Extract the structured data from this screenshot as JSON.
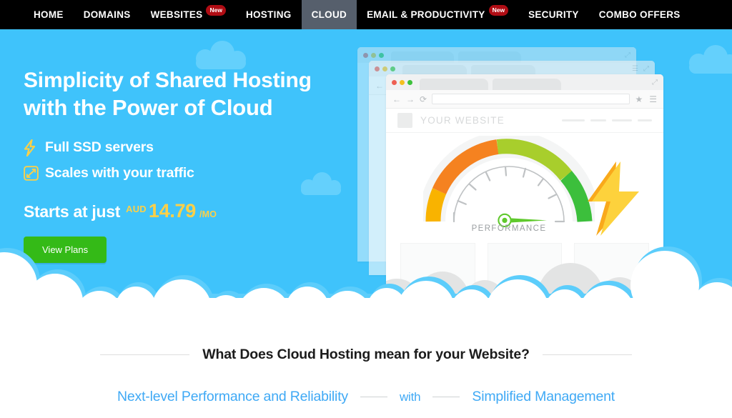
{
  "nav": {
    "items": [
      {
        "label": "HOME",
        "badge": null,
        "active": false
      },
      {
        "label": "DOMAINS",
        "badge": null,
        "active": false
      },
      {
        "label": "WEBSITES",
        "badge": "New",
        "active": false
      },
      {
        "label": "HOSTING",
        "badge": null,
        "active": false
      },
      {
        "label": "CLOUD",
        "badge": null,
        "active": true
      },
      {
        "label": "EMAIL & PRODUCTIVITY",
        "badge": "New",
        "active": false
      },
      {
        "label": "SECURITY",
        "badge": null,
        "active": false
      },
      {
        "label": "COMBO OFFERS",
        "badge": null,
        "active": false
      }
    ]
  },
  "hero": {
    "headline_line1": "Simplicity of Shared Hosting",
    "headline_line2": "with the Power of Cloud",
    "features": [
      {
        "icon": "lightning-bolt-icon",
        "label": "Full SSD servers"
      },
      {
        "icon": "scale-arrows-icon",
        "label": "Scales with your traffic"
      }
    ],
    "price": {
      "lead": "Starts at just",
      "currency": "AUD",
      "amount": "14.79",
      "period": "/MO"
    },
    "cta_label": "View Plans",
    "colors": {
      "background": "#3fc3fb",
      "cloud_decoration": "#64d0fc",
      "accent_yellow": "#fcd048",
      "cta_green": "#34ba17",
      "nav_active": "#565f6c",
      "badge_red": "#b00d14"
    }
  },
  "mockup": {
    "site_name": "YOUR WEBSITE",
    "gauge": {
      "label": "PERFORMANCE",
      "needle_color": "#5fc92c",
      "segments": [
        {
          "name": "low",
          "color": "#f9b300"
        },
        {
          "name": "medium",
          "color": "#f58220"
        },
        {
          "name": "high",
          "color": "#a8ce2c"
        },
        {
          "name": "peak",
          "color": "#3cbf3c"
        }
      ]
    },
    "bolt_color": "#fbc21c"
  },
  "lower": {
    "section_title": "What Does Cloud Hosting mean for your Website?",
    "links": {
      "left": "Next-level Performance and Reliability",
      "middle": "with",
      "right": "Simplified Management"
    },
    "link_color": "#3fa9f5"
  }
}
